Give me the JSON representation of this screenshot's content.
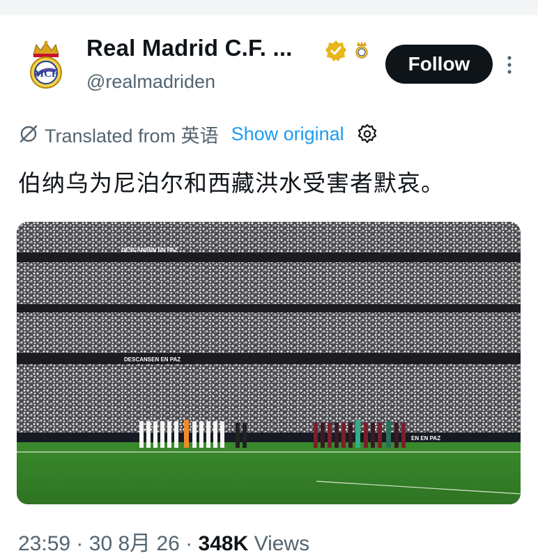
{
  "account": {
    "display_name": "Real Madrid C.F. ...",
    "handle": "@realmadriden",
    "follow_label": "Follow",
    "verified_color": "#e8b71a"
  },
  "translation": {
    "label": "Translated from 英语",
    "show_original": "Show original"
  },
  "tweet": {
    "text": "伯纳乌为尼泊尔和西藏洪水受害者默哀。"
  },
  "media": {
    "banner_upper": "DESCANSEN EN PAZ",
    "banner_lower": "DESCANSEN EN PAZ",
    "board_text": "EN EN PAZ"
  },
  "meta": {
    "time": "23:59",
    "date": "30 8月 26",
    "views_count": "348K",
    "views_label": "Views",
    "separator": "·"
  }
}
